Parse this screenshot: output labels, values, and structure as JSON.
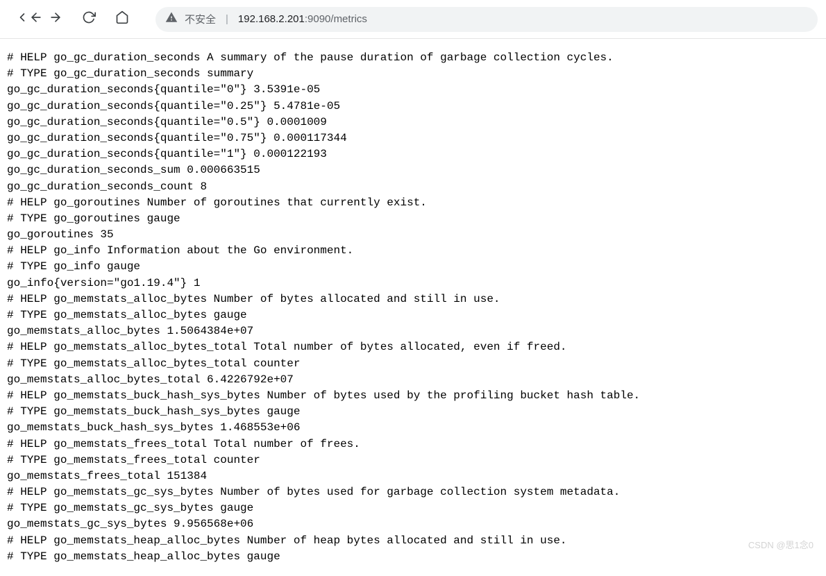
{
  "toolbar": {
    "security_label": "不安全",
    "url_host": "192.168.2.201",
    "url_rest": ":9090/metrics"
  },
  "metrics_lines": [
    "# HELP go_gc_duration_seconds A summary of the pause duration of garbage collection cycles.",
    "# TYPE go_gc_duration_seconds summary",
    "go_gc_duration_seconds{quantile=\"0\"} 3.5391e-05",
    "go_gc_duration_seconds{quantile=\"0.25\"} 5.4781e-05",
    "go_gc_duration_seconds{quantile=\"0.5\"} 0.0001009",
    "go_gc_duration_seconds{quantile=\"0.75\"} 0.000117344",
    "go_gc_duration_seconds{quantile=\"1\"} 0.000122193",
    "go_gc_duration_seconds_sum 0.000663515",
    "go_gc_duration_seconds_count 8",
    "# HELP go_goroutines Number of goroutines that currently exist.",
    "# TYPE go_goroutines gauge",
    "go_goroutines 35",
    "# HELP go_info Information about the Go environment.",
    "# TYPE go_info gauge",
    "go_info{version=\"go1.19.4\"} 1",
    "# HELP go_memstats_alloc_bytes Number of bytes allocated and still in use.",
    "# TYPE go_memstats_alloc_bytes gauge",
    "go_memstats_alloc_bytes 1.5064384e+07",
    "# HELP go_memstats_alloc_bytes_total Total number of bytes allocated, even if freed.",
    "# TYPE go_memstats_alloc_bytes_total counter",
    "go_memstats_alloc_bytes_total 6.4226792e+07",
    "# HELP go_memstats_buck_hash_sys_bytes Number of bytes used by the profiling bucket hash table.",
    "# TYPE go_memstats_buck_hash_sys_bytes gauge",
    "go_memstats_buck_hash_sys_bytes 1.468553e+06",
    "# HELP go_memstats_frees_total Total number of frees.",
    "# TYPE go_memstats_frees_total counter",
    "go_memstats_frees_total 151384",
    "# HELP go_memstats_gc_sys_bytes Number of bytes used for garbage collection system metadata.",
    "# TYPE go_memstats_gc_sys_bytes gauge",
    "go_memstats_gc_sys_bytes 9.956568e+06",
    "# HELP go_memstats_heap_alloc_bytes Number of heap bytes allocated and still in use.",
    "# TYPE go_memstats_heap_alloc_bytes gauge"
  ],
  "watermark": "CSDN @思1念0"
}
